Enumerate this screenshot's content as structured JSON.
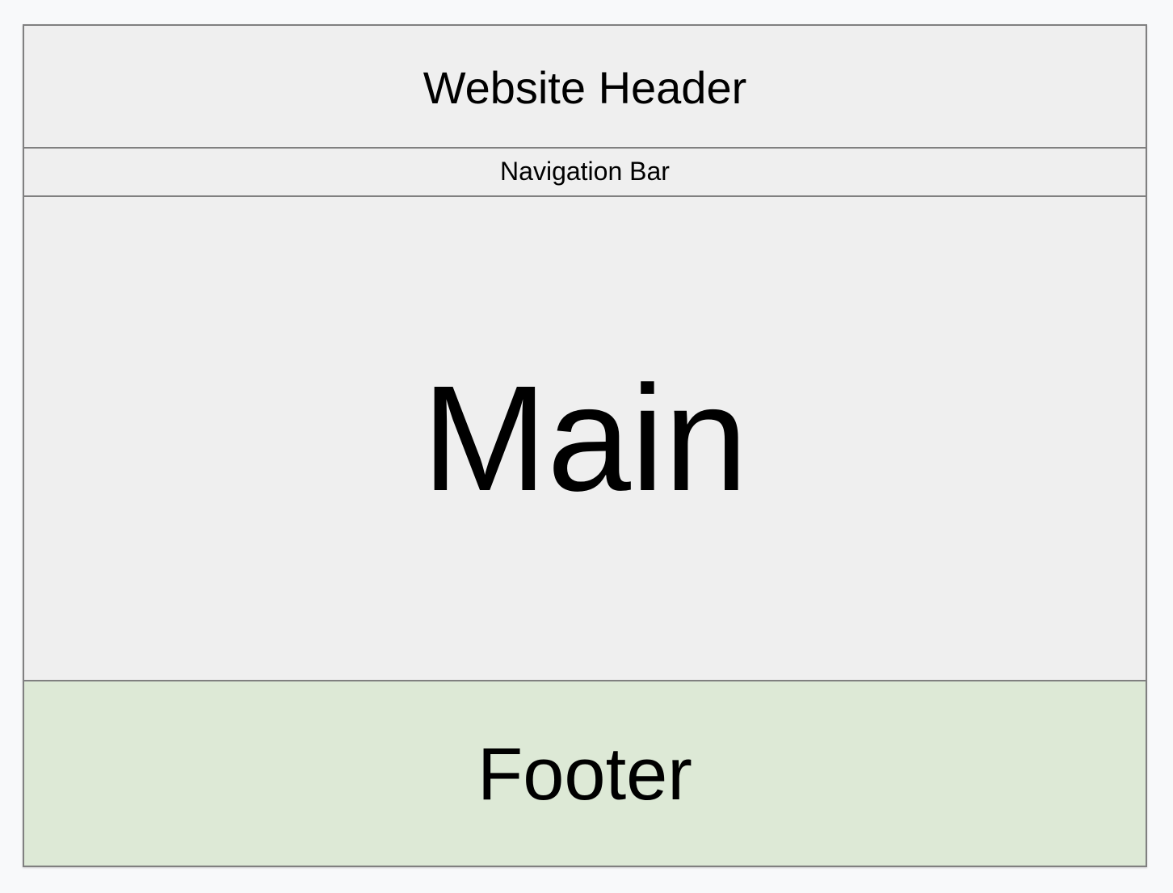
{
  "layout": {
    "header_label": "Website Header",
    "nav_label": "Navigation Bar",
    "main_label": "Main",
    "footer_label": "Footer"
  },
  "colors": {
    "page_background": "#f8f9fa",
    "region_fill": "#efefef",
    "footer_fill": "#dde9d6",
    "border": "#808080",
    "text": "#000000"
  }
}
